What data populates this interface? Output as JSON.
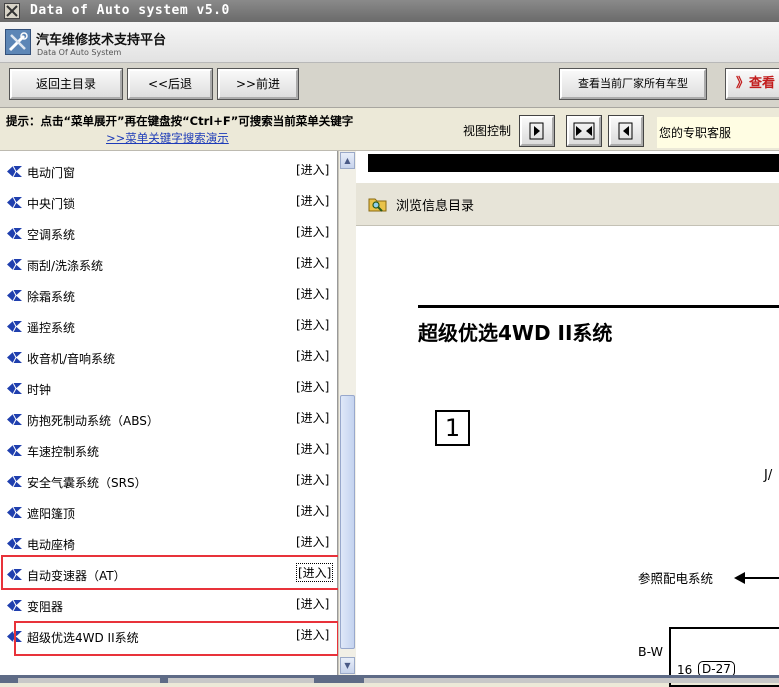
{
  "window": {
    "title": "Data of Auto system v5.0"
  },
  "app": {
    "title": "汽车维修技术支持平台",
    "subtitle": "Data Of Auto System"
  },
  "toolbar": {
    "home_label": "返回主目录",
    "back_label": "<<后退",
    "forward_label": ">>前进",
    "models_label": "查看当前厂家所有车型",
    "view_label": "》查看"
  },
  "hint": {
    "text": "提示：点击“菜单展开”再在键盘按“Ctrl+F”可搜索当前菜单关键字",
    "link": ">>菜单关键字搜索演示",
    "view_control": "视图控制",
    "support": "您的专职客服"
  },
  "menu": {
    "enter_label": "[进入]",
    "items": [
      {
        "label": "电动门窗"
      },
      {
        "label": "中央门锁"
      },
      {
        "label": "空调系统"
      },
      {
        "label": "雨刮/洗涤系统"
      },
      {
        "label": "除霜系统"
      },
      {
        "label": "遥控系统"
      },
      {
        "label": "收音机/音响系统"
      },
      {
        "label": "时钟"
      },
      {
        "label": "防抱死制动系统（ABS）"
      },
      {
        "label": "车速控制系统"
      },
      {
        "label": "安全气囊系统（SRS）"
      },
      {
        "label": "遮阳篷顶"
      },
      {
        "label": "电动座椅"
      },
      {
        "label": "自动变速器（AT）"
      },
      {
        "label": "变阻器"
      },
      {
        "label": "超级优选4WD II系统"
      }
    ]
  },
  "content": {
    "browse_label": "浏览信息目录",
    "doc_title": "超级优选4WD II系统",
    "section_number": "1",
    "connector_label": "J/",
    "ref_label": "参照配电系统",
    "wire_label": "B-W",
    "pin_label": "16",
    "connector_code": "D-27"
  },
  "colors": {
    "highlight": "#e8323a",
    "link": "#1d3bb8",
    "bullet": "#1f3fae"
  }
}
